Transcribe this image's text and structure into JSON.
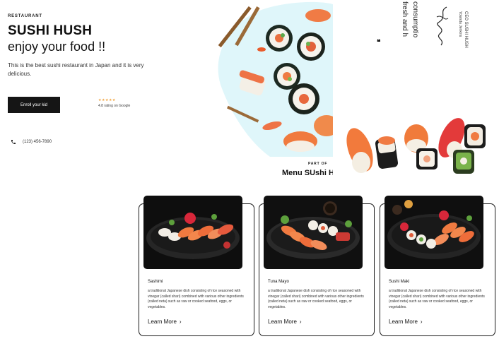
{
  "hero": {
    "eyebrow": "RESTAURANT",
    "brand": "SUSHI HUSH",
    "tagline": "enjoy your food !!",
    "description": "This is the best sushi restaurant in Japan and it is very delicious.",
    "cta_label": "Enroll your kid",
    "stars": "★★★★★",
    "rating_text": "4.8 rating on Google",
    "phone": "(123) 456-7890"
  },
  "section": {
    "eyebrow": "PART OF",
    "title": "Menu SUshi HUSH"
  },
  "testimonial": {
    "quote_mark": "❝",
    "line1": "fresh and h",
    "line2": "consumptio",
    "name": "Yolanda Jenkins",
    "role": "CEO SUSHI HUSH"
  },
  "cards": [
    {
      "title": "Sashimi",
      "description": "a traditional Japanese dish consisting of rice seasoned with vinegar (called shari) combined with various other ingredients (called neta) such as raw or cooked seafood, eggs, or vegetables.",
      "link_label": "Learn More",
      "chevron": "›"
    },
    {
      "title": "Tuna Mayo",
      "description": "a traditional Japanese dish consisting of rice seasoned with vinegar (called shari) combined with various other ingredients (called neta) such as raw or cooked seafood, eggs, or vegetables.",
      "link_label": "Learn More",
      "chevron": "›"
    },
    {
      "title": "Sushi Maki",
      "description": "a traditional Japanese dish consisting of rice seasoned with vinegar (called shari) combined with various other ingredients (called neta) such as raw or cooked seafood, eggs, or vegetables.",
      "link_label": "Learn More",
      "chevron": "›"
    }
  ],
  "icons": {
    "phone": "phone-icon",
    "star": "star-icon",
    "chevron": "chevron-right-icon"
  },
  "colors": {
    "accent_dark": "#151515",
    "star": "#f0a23a",
    "hero_blob": "#dff6fa"
  }
}
